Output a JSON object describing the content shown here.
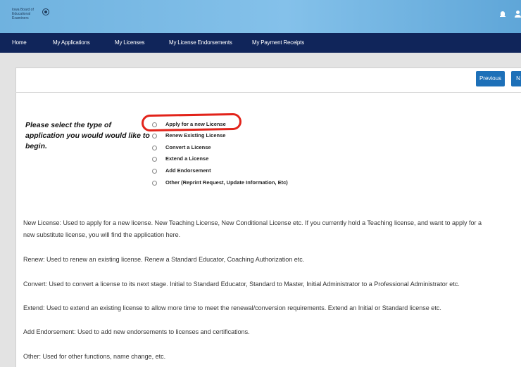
{
  "header": {
    "brand_lines": [
      "Iowa Board of",
      "Educational",
      "Examiners"
    ],
    "icons": [
      "seal-icon",
      "bell-icon",
      "user-icon"
    ]
  },
  "nav": {
    "items": [
      "Home",
      "My Applications",
      "My Licenses",
      "My License Endorsements",
      "My Payment Receipts"
    ]
  },
  "toolbar": {
    "previous_label": "Previous",
    "next_label": "N"
  },
  "form": {
    "prompt": "Please select the type of application you would would like to begin.",
    "options": [
      "Apply for a new License",
      "Renew Existing License",
      "Convert a License",
      "Extend a License",
      "Add Endorsement",
      "Other (Reprint Request, Update Information, Etc)"
    ]
  },
  "descriptions": {
    "new_line1": "New License: Used to apply for a new license. New Teaching License, New Conditional License etc. If you currently hold a Teaching license, and want to apply for a",
    "new_line2": "new substitute license, you will find the application here.",
    "renew": "Renew: Used to renew an existing license. Renew a Standard Educator, Coaching Authorization etc.",
    "convert": "Convert: Used to convert a license to its next stage. Initial to Standard Educator, Standard to Master, Initial Administrator to a Professional Administrator etc.",
    "extend": "Extend: Used to extend an existing license to allow more time to meet the renewal/conversion requirements. Extend an Initial or Standard license etc.",
    "add_endorsement": "Add Endorsement: Used to add new endorsements to licenses and certifications.",
    "other": "Other: Used for other functions, name change, etc."
  },
  "colors": {
    "topbar": "#7ab8e3",
    "navbar": "#10255a",
    "button": "#1d70b8",
    "highlight": "#e2231a"
  }
}
